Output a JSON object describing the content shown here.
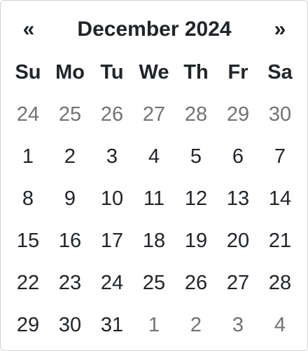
{
  "header": {
    "prev_label": "«",
    "title": "December 2024",
    "next_label": "»"
  },
  "weekdays": [
    "Su",
    "Mo",
    "Tu",
    "We",
    "Th",
    "Fr",
    "Sa"
  ],
  "weeks": [
    [
      {
        "day": "24",
        "muted": true
      },
      {
        "day": "25",
        "muted": true
      },
      {
        "day": "26",
        "muted": true
      },
      {
        "day": "27",
        "muted": true
      },
      {
        "day": "28",
        "muted": true
      },
      {
        "day": "29",
        "muted": true
      },
      {
        "day": "30",
        "muted": true
      }
    ],
    [
      {
        "day": "1",
        "muted": false
      },
      {
        "day": "2",
        "muted": false
      },
      {
        "day": "3",
        "muted": false
      },
      {
        "day": "4",
        "muted": false
      },
      {
        "day": "5",
        "muted": false
      },
      {
        "day": "6",
        "muted": false
      },
      {
        "day": "7",
        "muted": false
      }
    ],
    [
      {
        "day": "8",
        "muted": false
      },
      {
        "day": "9",
        "muted": false
      },
      {
        "day": "10",
        "muted": false
      },
      {
        "day": "11",
        "muted": false
      },
      {
        "day": "12",
        "muted": false
      },
      {
        "day": "13",
        "muted": false
      },
      {
        "day": "14",
        "muted": false
      }
    ],
    [
      {
        "day": "15",
        "muted": false
      },
      {
        "day": "16",
        "muted": false
      },
      {
        "day": "17",
        "muted": false
      },
      {
        "day": "18",
        "muted": false
      },
      {
        "day": "19",
        "muted": false
      },
      {
        "day": "20",
        "muted": false
      },
      {
        "day": "21",
        "muted": false
      }
    ],
    [
      {
        "day": "22",
        "muted": false
      },
      {
        "day": "23",
        "muted": false
      },
      {
        "day": "24",
        "muted": false
      },
      {
        "day": "25",
        "muted": false
      },
      {
        "day": "26",
        "muted": false
      },
      {
        "day": "27",
        "muted": false
      },
      {
        "day": "28",
        "muted": false
      }
    ],
    [
      {
        "day": "29",
        "muted": false
      },
      {
        "day": "30",
        "muted": false
      },
      {
        "day": "31",
        "muted": false
      },
      {
        "day": "1",
        "muted": true
      },
      {
        "day": "2",
        "muted": true
      },
      {
        "day": "3",
        "muted": true
      },
      {
        "day": "4",
        "muted": true
      }
    ]
  ],
  "colors": {
    "text": "#212529",
    "muted_text": "#737373",
    "border": "#d4d4d4",
    "background": "#ffffff"
  }
}
